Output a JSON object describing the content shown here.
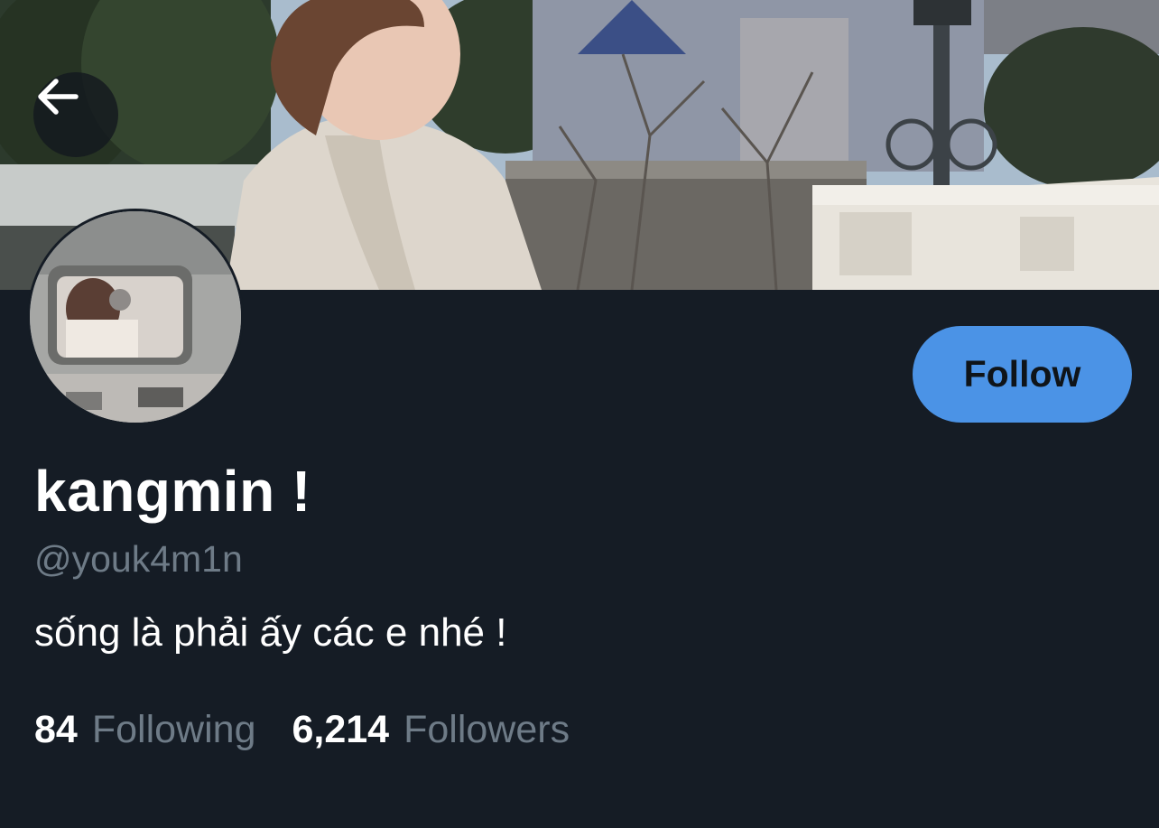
{
  "header": {
    "back_icon": "arrow-left-icon"
  },
  "profile": {
    "follow_label": "Follow",
    "display_name": "kangmin !",
    "handle": "@youk4m1n",
    "bio": "sống là phải ấy các e nhé !",
    "following_count": "84",
    "following_label": "Following",
    "followers_count": "6,214",
    "followers_label": "Followers"
  },
  "colors": {
    "background": "#151c25",
    "accent": "#4b93e6",
    "secondary_text": "#6e7b87",
    "primary_text": "#ffffff"
  }
}
